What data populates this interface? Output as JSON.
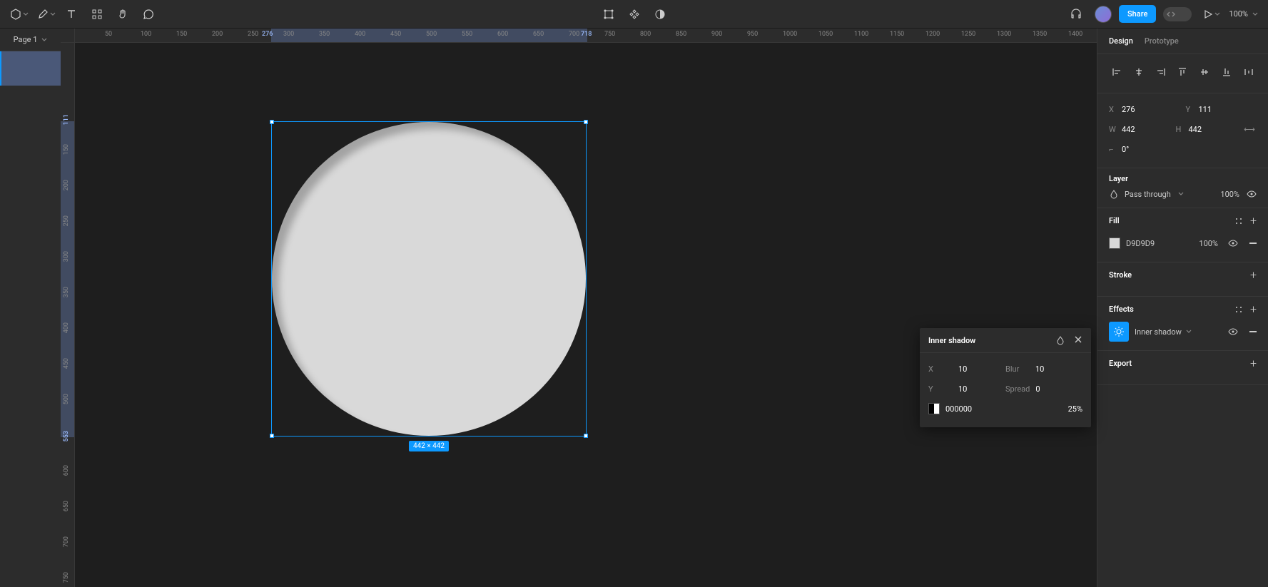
{
  "toolbar": {
    "share": "Share",
    "zoom": "100%"
  },
  "pages": {
    "current": "Page 1"
  },
  "ruler": {
    "h_ticks": [
      50,
      100,
      150,
      200,
      250,
      300,
      350,
      400,
      450,
      500,
      550,
      600,
      650,
      700,
      750,
      800,
      850,
      900,
      950,
      1000,
      1050,
      1100,
      1150,
      1200,
      1250,
      1300,
      1350,
      1400
    ],
    "v_ticks": [
      150,
      200,
      250,
      300,
      350,
      400,
      450,
      500,
      600,
      650,
      700,
      750
    ],
    "sel_x1": "276",
    "sel_x2": "718",
    "sel_y1": "111",
    "sel_y2": "553"
  },
  "selection": {
    "label": "442 × 442"
  },
  "tabs": {
    "design": "Design",
    "prototype": "Prototype"
  },
  "transform": {
    "x_label": "X",
    "x": "276",
    "y_label": "Y",
    "y": "111",
    "w_label": "W",
    "w": "442",
    "h_label": "H",
    "h": "442",
    "rot": "0°"
  },
  "layer": {
    "title": "Layer",
    "blend": "Pass through",
    "opacity": "100%"
  },
  "fill": {
    "title": "Fill",
    "hex": "D9D9D9",
    "opacity": "100%"
  },
  "stroke": {
    "title": "Stroke"
  },
  "effects": {
    "title": "Effects",
    "item": "Inner shadow"
  },
  "export": {
    "title": "Export"
  },
  "shadow_popup": {
    "title": "Inner shadow",
    "x_label": "X",
    "x": "10",
    "y_label": "Y",
    "y": "10",
    "blur_label": "Blur",
    "blur": "10",
    "spread_label": "Spread",
    "spread": "0",
    "color": "000000",
    "opacity": "25%"
  }
}
